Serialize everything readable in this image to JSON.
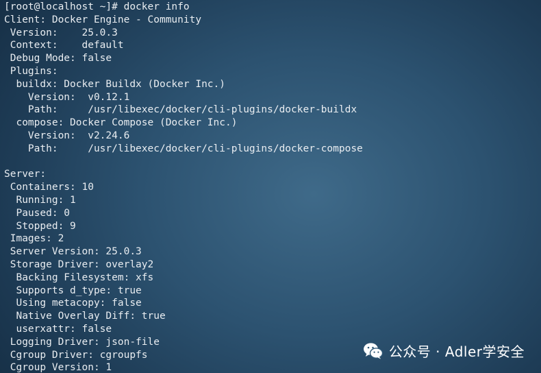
{
  "terminal": {
    "lines": [
      "[root@localhost ~]# docker info",
      "Client: Docker Engine - Community",
      " Version:    25.0.3",
      " Context:    default",
      " Debug Mode: false",
      " Plugins:",
      "  buildx: Docker Buildx (Docker Inc.)",
      "    Version:  v0.12.1",
      "    Path:     /usr/libexec/docker/cli-plugins/docker-buildx",
      "  compose: Docker Compose (Docker Inc.)",
      "    Version:  v2.24.6",
      "    Path:     /usr/libexec/docker/cli-plugins/docker-compose",
      "",
      "Server:",
      " Containers: 10",
      "  Running: 1",
      "  Paused: 0",
      "  Stopped: 9",
      " Images: 2",
      " Server Version: 25.0.3",
      " Storage Driver: overlay2",
      "  Backing Filesystem: xfs",
      "  Supports d_type: true",
      "  Using metacopy: false",
      "  Native Overlay Diff: true",
      "  userxattr: false",
      " Logging Driver: json-file",
      " Cgroup Driver: cgroupfs",
      " Cgroup Version: 1"
    ]
  },
  "watermark": {
    "icon": "wechat-icon",
    "text": "公众号 · Adler学安全"
  }
}
